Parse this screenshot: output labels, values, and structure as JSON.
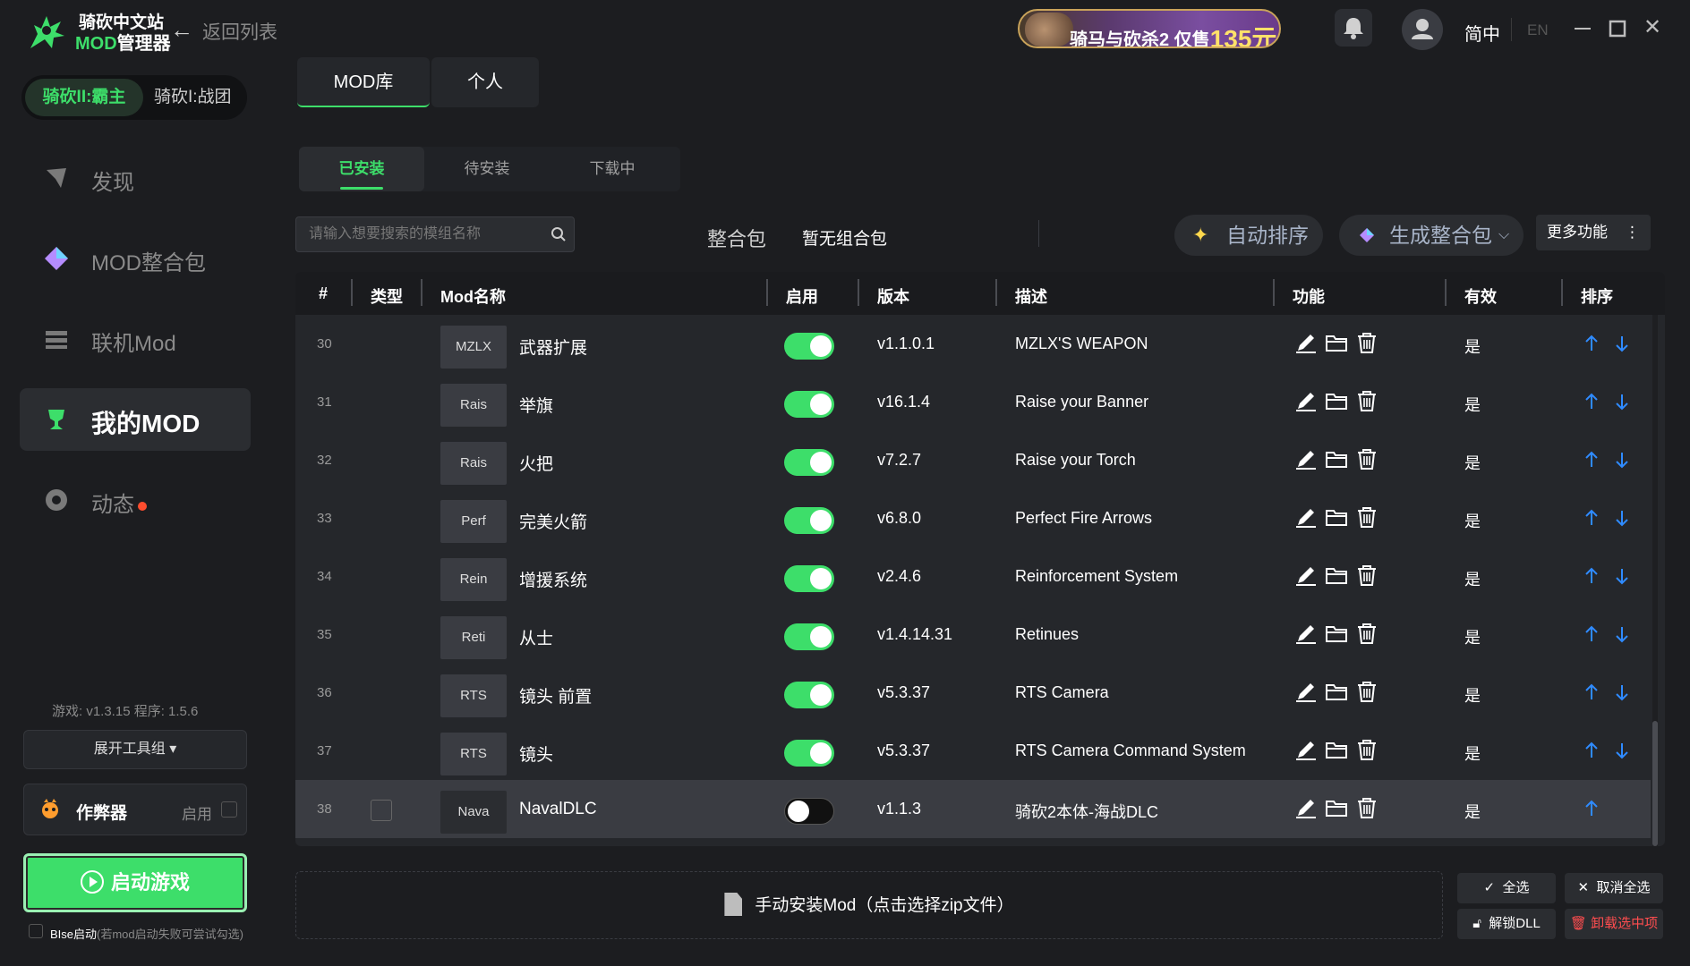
{
  "header": {
    "logo_line1": "骑砍中文站",
    "logo_mod": "MOD",
    "logo_line2_rest": "管理器",
    "back_label": "返回列表",
    "banner_text": "骑马与砍杀2 仅售",
    "banner_price": "135元",
    "lang_active": "简中",
    "lang_inactive": "EN"
  },
  "sidebar": {
    "game_active": "骑砍II:霸主",
    "game_inactive": "骑砍I:战团",
    "nav": [
      {
        "label": "发现"
      },
      {
        "label": "MOD整合包"
      },
      {
        "label": "联机Mod"
      },
      {
        "label": "我的MOD"
      },
      {
        "label": "动态"
      }
    ],
    "version_info": "游戏: v1.3.15    程序: 1.5.6",
    "tools_label": "展开工具组 ▾",
    "cheat_label": "作弊器",
    "cheat_enable": "启用",
    "launch_label": "启动游戏",
    "bise_label": "BIse启动",
    "bise_sub": "(若mod启动失败可尝试勾选)"
  },
  "main": {
    "tabs": [
      "MOD库",
      "个人"
    ],
    "sub_tabs": [
      "已安装",
      "待安装",
      "下载中"
    ],
    "search_placeholder": "请输入想要搜索的模组名称",
    "pack_label": "整合包",
    "pack_value": "暂无组合包",
    "auto_sort": "自动排序",
    "gen_pack": "生成整合包",
    "more": "更多功能",
    "columns": [
      "#",
      "类型",
      "Mod名称",
      "启用",
      "版本",
      "描述",
      "功能",
      "有效",
      "排序"
    ],
    "rows": [
      {
        "num": "30",
        "badge": "MZLX",
        "name": "武器扩展",
        "enabled": true,
        "version": "v1.1.0.1",
        "desc": "MZLX'S WEAPON",
        "valid": "是"
      },
      {
        "num": "31",
        "badge": "Rais",
        "name": "举旗",
        "enabled": true,
        "version": "v16.1.4",
        "desc": "Raise your Banner",
        "valid": "是"
      },
      {
        "num": "32",
        "badge": "Rais",
        "name": "火把",
        "enabled": true,
        "version": "v7.2.7",
        "desc": "Raise your Torch",
        "valid": "是"
      },
      {
        "num": "33",
        "badge": "Perf",
        "name": "完美火箭",
        "enabled": true,
        "version": "v6.8.0",
        "desc": "Perfect Fire Arrows",
        "valid": "是"
      },
      {
        "num": "34",
        "badge": "Rein",
        "name": "增援系统",
        "enabled": true,
        "version": "v2.4.6",
        "desc": "Reinforcement System",
        "valid": "是"
      },
      {
        "num": "35",
        "badge": "Reti",
        "name": "从士",
        "enabled": true,
        "version": "v1.4.14.31",
        "desc": "Retinues",
        "valid": "是"
      },
      {
        "num": "36",
        "badge": "RTS",
        "name": "镜头 前置",
        "enabled": true,
        "version": "v5.3.37",
        "desc": "RTS Camera",
        "valid": "是"
      },
      {
        "num": "37",
        "badge": "RTS",
        "name": "镜头",
        "enabled": true,
        "version": "v5.3.37",
        "desc": "RTS Camera Command System",
        "valid": "是"
      },
      {
        "num": "38",
        "badge": "Nava",
        "name": "NavalDLC",
        "enabled": false,
        "version": "v1.1.3",
        "desc": "骑砍2本体-海战DLC",
        "valid": "是"
      }
    ],
    "manual_install": "手动安装Mod（点击选择zip文件）",
    "select_all": "全选",
    "deselect_all": "取消全选",
    "unlock_dll": "解锁DLL",
    "uninstall_selected": "卸载选中项"
  },
  "colors": {
    "accent": "#3dde6a",
    "background": "#1c1d20",
    "panel": "#25272b",
    "danger": "#ff4d4f",
    "arrow": "#2f8bff"
  }
}
